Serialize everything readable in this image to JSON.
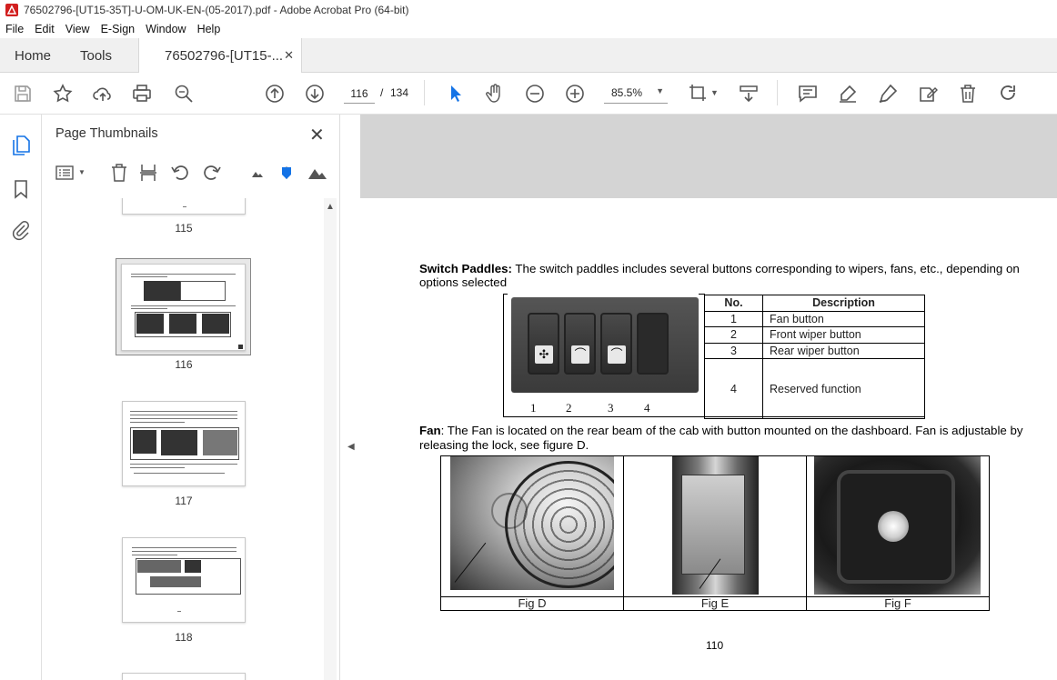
{
  "window": {
    "title": "76502796-[UT15-35T]-U-OM-UK-EN-(05-2017).pdf - Adobe Acrobat Pro (64-bit)"
  },
  "menu": [
    "File",
    "Edit",
    "View",
    "E-Sign",
    "Window",
    "Help"
  ],
  "tabs": {
    "home": "Home",
    "tools": "Tools",
    "document": "76502796-[UT15-..."
  },
  "toolbar": {
    "current_page": "116",
    "page_separator": "/",
    "total_pages": "134",
    "zoom": "85.5%",
    "icons": [
      "save-icon",
      "star-icon",
      "upload-icon",
      "print-icon",
      "zoom-search-icon",
      "page-up-icon",
      "page-down-icon",
      "select-cursor-icon",
      "hand-icon",
      "zoom-out-icon",
      "zoom-in-icon",
      "crop-icon",
      "scroll-mode-icon",
      "comment-icon",
      "highlight-icon",
      "sign-icon",
      "edit-icon",
      "delete-icon",
      "redo-icon"
    ]
  },
  "thumbnails_panel": {
    "title": "Page Thumbnails",
    "pages": [
      {
        "label": "115"
      },
      {
        "label": "116",
        "selected": true
      },
      {
        "label": "117"
      },
      {
        "label": "118"
      }
    ]
  },
  "document": {
    "switch_paddles": {
      "heading": "Switch Paddles:",
      "text": " The switch paddles includes several buttons corresponding to wipers, fans, etc., depending on options selected",
      "photo_labels": [
        "1",
        "2",
        "3",
        "4"
      ],
      "table": {
        "headers": [
          "No.",
          "Description"
        ],
        "rows": [
          {
            "no": "1",
            "desc": "Fan button"
          },
          {
            "no": "2",
            "desc": "Front wiper button"
          },
          {
            "no": "3",
            "desc": "Rear wiper button"
          },
          {
            "no": "4",
            "desc": "Reserved function"
          }
        ]
      }
    },
    "fan": {
      "heading": "Fan",
      "text": ": The Fan is located on the rear beam of the cab with button mounted on the dashboard. Fan is adjustable by releasing the lock, see figure D."
    },
    "figures": [
      "Fig D",
      "Fig E",
      "Fig F"
    ],
    "page_number": "110"
  }
}
